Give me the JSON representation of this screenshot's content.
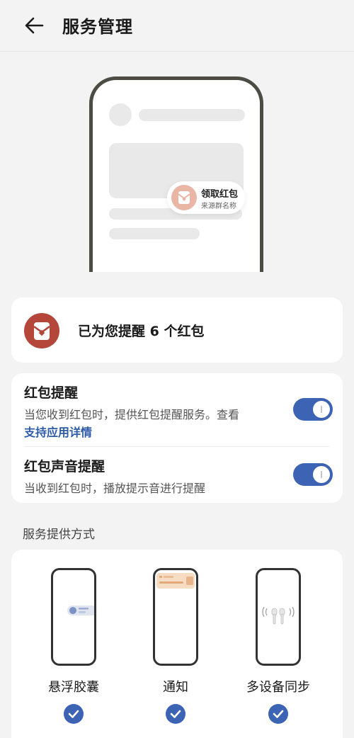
{
  "header": {
    "title": "服务管理",
    "back_icon": "arrow-left-icon"
  },
  "hero": {
    "pill_title": "领取红包",
    "pill_subtitle": "来源群名称",
    "pill_icon": "red-envelope-icon"
  },
  "stat": {
    "text": "已为您提醒 6 个红包",
    "icon": "red-envelope-icon",
    "icon_color": "#b4473a"
  },
  "settings": {
    "items": [
      {
        "title": "红包提醒",
        "desc": "当您收到红包时，提供红包提醒服务。查看",
        "link": "支持应用详情",
        "enabled": true
      },
      {
        "title": "红包声音提醒",
        "desc": "当收到红包时，播放提示音进行提醒",
        "enabled": true
      }
    ]
  },
  "section": {
    "label": "服务提供方式"
  },
  "methods": [
    {
      "label": "悬浮胶囊",
      "checked": true,
      "icon": "floating-capsule-icon"
    },
    {
      "label": "通知",
      "checked": true,
      "icon": "notification-banner-icon"
    },
    {
      "label": "多设备同步",
      "checked": true,
      "icon": "earbuds-icon"
    }
  ],
  "colors": {
    "accent": "#3d63b5",
    "red_envelope": "#b4473a",
    "link": "#2d5ba7"
  }
}
